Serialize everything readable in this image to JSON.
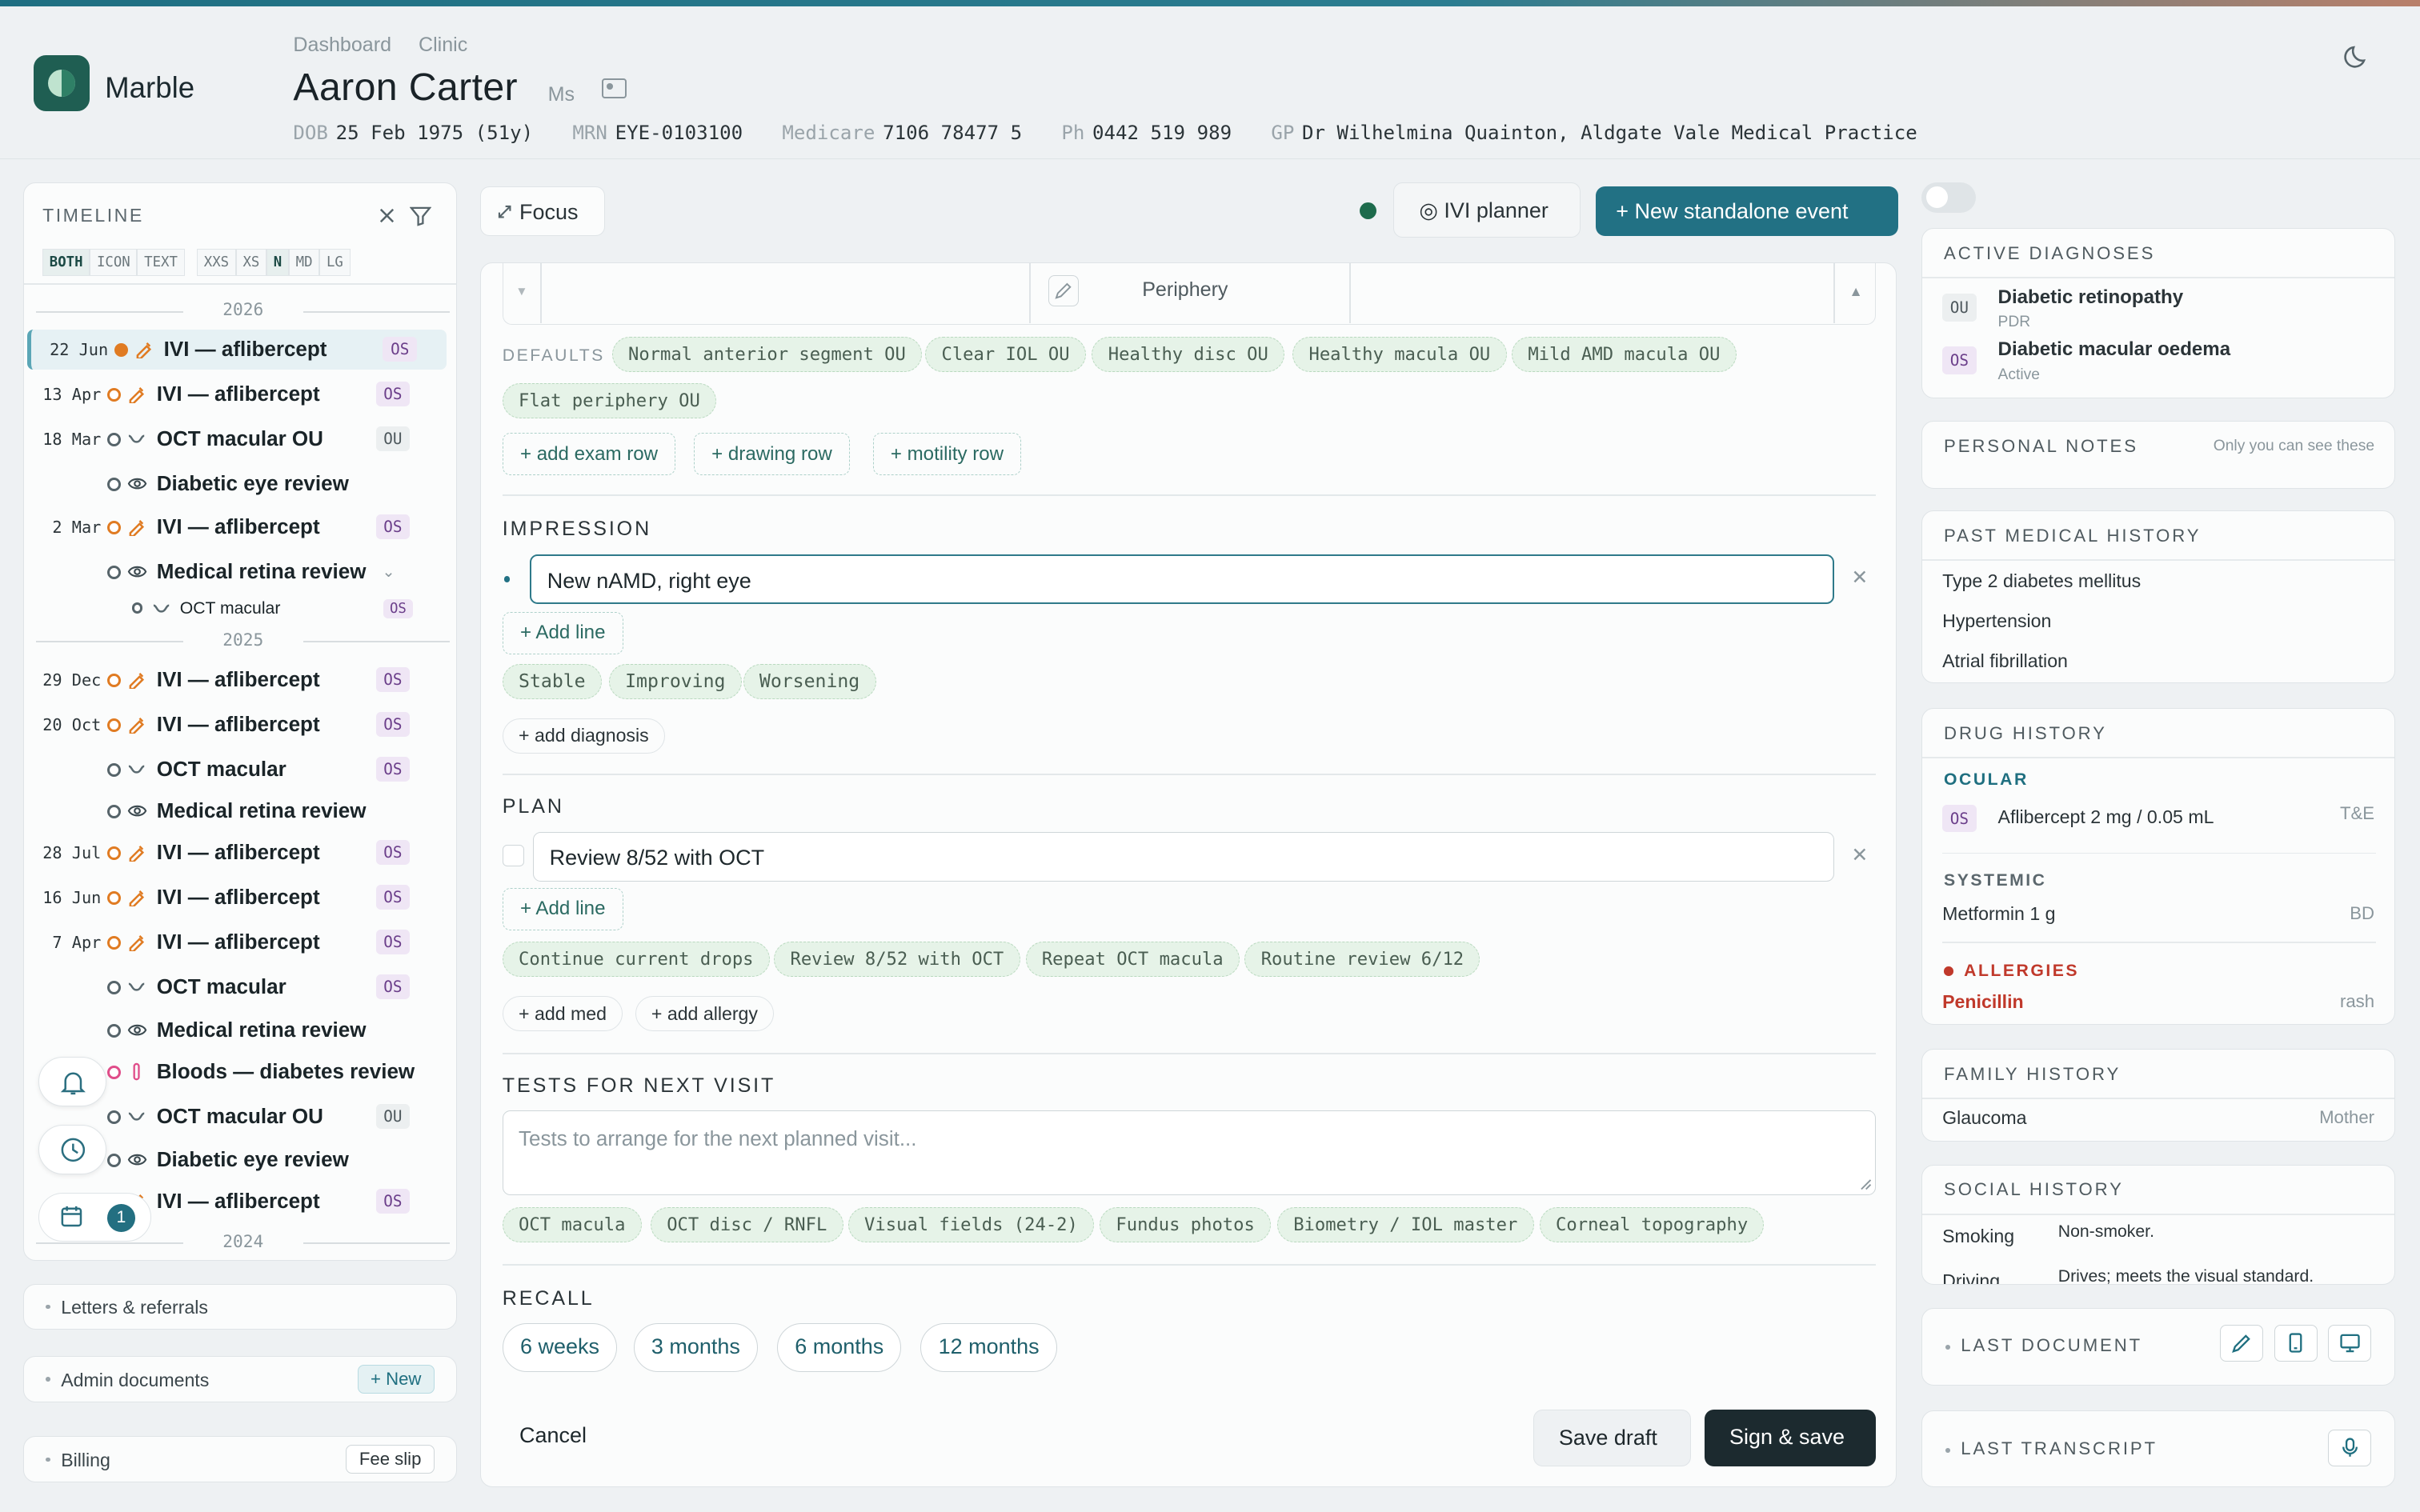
{
  "app": {
    "name": "Marble"
  },
  "breadcrumb": [
    "Dashboard",
    "Clinic"
  ],
  "patient": {
    "name": "Aaron Carter",
    "title": "Ms",
    "dob_label": "DOB",
    "dob": "25 Feb 1975 (51y)",
    "mrn_label": "MRN",
    "mrn": "EYE-0103100",
    "medicare_label": "Medicare",
    "medicare": "7106 78477 5",
    "ph_label": "Ph",
    "ph": "0442 519 989",
    "gp_label": "GP",
    "gp": "Dr Wilhelmina Quainton, Aldgate Vale Medical Practice"
  },
  "timeline": {
    "title": "TIMELINE",
    "view_modes": [
      "BOTH",
      "ICON",
      "TEXT"
    ],
    "sizes": [
      "XXS",
      "XS",
      "N",
      "MD",
      "LG"
    ],
    "years": [
      "2026",
      "2025",
      "2024"
    ],
    "events": [
      {
        "date": "22 Jun",
        "title": "IVI — aflibercept",
        "eye": "OS",
        "icon": "syringe-icon",
        "selected": true
      },
      {
        "date": "13 Apr",
        "title": "IVI — aflibercept",
        "eye": "OS",
        "icon": "syringe-icon"
      },
      {
        "date": "18 Mar",
        "title": "OCT macular OU",
        "eye": "OU",
        "icon": "scan-icon"
      },
      {
        "date": "",
        "title": "Diabetic eye review",
        "eye": "",
        "icon": "eye-icon"
      },
      {
        "date": "2 Mar",
        "title": "IVI — aflibercept",
        "eye": "OS",
        "icon": "syringe-icon"
      },
      {
        "date": "",
        "title": "Medical retina review",
        "eye": "",
        "icon": "eye-icon"
      },
      {
        "date": "",
        "title": "OCT macular",
        "eye": "OS",
        "icon": "scan-icon"
      },
      {
        "date": "29 Dec",
        "title": "IVI — aflibercept",
        "eye": "OS",
        "icon": "syringe-icon"
      },
      {
        "date": "20 Oct",
        "title": "IVI — aflibercept",
        "eye": "OS",
        "icon": "syringe-icon"
      },
      {
        "date": "",
        "title": "OCT macular",
        "eye": "OS",
        "icon": "scan-icon"
      },
      {
        "date": "",
        "title": "Medical retina review",
        "eye": "",
        "icon": "eye-icon"
      },
      {
        "date": "28 Jul",
        "title": "IVI — aflibercept",
        "eye": "OS",
        "icon": "syringe-icon"
      },
      {
        "date": "16 Jun",
        "title": "IVI — aflibercept",
        "eye": "OS",
        "icon": "syringe-icon"
      },
      {
        "date": "7 Apr",
        "title": "IVI — aflibercept",
        "eye": "OS",
        "icon": "syringe-icon"
      },
      {
        "date": "",
        "title": "OCT macular",
        "eye": "OS",
        "icon": "scan-icon"
      },
      {
        "date": "",
        "title": "Medical retina review",
        "eye": "",
        "icon": "eye-icon"
      },
      {
        "date": "",
        "title": "Bloods — diabetes review",
        "eye": "",
        "icon": "blood-tube-icon"
      },
      {
        "date": "",
        "title": "OCT macular OU",
        "eye": "OU",
        "icon": "scan-icon"
      },
      {
        "date": "",
        "title": "Diabetic eye review",
        "eye": "",
        "icon": "eye-icon"
      },
      {
        "date": "",
        "title": "IVI — aflibercept",
        "eye": "OS",
        "icon": "syringe-icon"
      }
    ],
    "notification_count": "1"
  },
  "side_sections": {
    "letters": "Letters & referrals",
    "admin": "Admin documents",
    "admin_new": "+ New",
    "billing": "Billing",
    "fee_slip": "Fee slip"
  },
  "toolbar": {
    "focus": "Focus",
    "ivi_planner": "◎ IVI planner",
    "new_event": "+ New standalone event"
  },
  "exam": {
    "periphery_label": "Periphery",
    "defaults_label": "DEFAULTS",
    "defaults": [
      "Normal anterior segment OU",
      "Clear IOL OU",
      "Healthy disc OU",
      "Healthy macula OU",
      "Mild AMD macula OU",
      "Flat periphery OU"
    ],
    "add_buttons": [
      "+ add exam row",
      "+ drawing row",
      "+ motility row"
    ]
  },
  "impression": {
    "title": "IMPRESSION",
    "line": "New nAMD, right eye",
    "add_line": "+ Add line",
    "status_chips": [
      "Stable",
      "Improving",
      "Worsening"
    ],
    "add_diagnosis": "+ add diagnosis"
  },
  "plan": {
    "title": "PLAN",
    "line": "Review 8/52 with OCT",
    "add_line": "+ Add line",
    "chips": [
      "Continue current drops",
      "Review 8/52 with OCT",
      "Repeat OCT macula",
      "Routine review 6/12"
    ],
    "add_med": "+ add med",
    "add_allergy": "+ add allergy"
  },
  "tests": {
    "title": "TESTS FOR NEXT VISIT",
    "placeholder": "Tests to arrange for the next planned visit...",
    "chips": [
      "OCT macula",
      "OCT disc / RNFL",
      "Visual fields (24-2)",
      "Fundus photos",
      "Biometry / IOL master",
      "Corneal topography"
    ]
  },
  "recall": {
    "title": "RECALL",
    "options": [
      "6 weeks",
      "3 months",
      "6 months",
      "12 months"
    ]
  },
  "footer": {
    "cancel": "Cancel",
    "save_draft": "Save draft",
    "sign_save": "Sign & save"
  },
  "right": {
    "active_diagnoses": {
      "title": "ACTIVE DIAGNOSES",
      "items": [
        {
          "eye": "OU",
          "name": "Diabetic retinopathy",
          "sub": "PDR"
        },
        {
          "eye": "OS",
          "name": "Diabetic macular oedema",
          "sub": "Active"
        }
      ]
    },
    "personal_notes": {
      "title": "PERSONAL NOTES",
      "hint": "Only you can see these"
    },
    "pmh": {
      "title": "PAST MEDICAL HISTORY",
      "items": [
        "Type 2 diabetes mellitus",
        "Hypertension",
        "Atrial fibrillation"
      ]
    },
    "drug_history": {
      "title": "DRUG HISTORY",
      "ocular_label": "OCULAR",
      "ocular": {
        "eye": "OS",
        "name": "Aflibercept 2 mg / 0.05 mL",
        "freq": "T&E"
      },
      "systemic_label": "SYSTEMIC",
      "systemic": {
        "name": "Metformin 1 g",
        "freq": "BD"
      },
      "allergies_label": "ALLERGIES",
      "allergy": {
        "name": "Penicillin",
        "reaction": "rash"
      }
    },
    "family_history": {
      "title": "FAMILY HISTORY",
      "item": "Glaucoma",
      "relation": "Mother"
    },
    "social_history": {
      "title": "SOCIAL HISTORY",
      "rows": [
        {
          "k": "Smoking",
          "v": "Non-smoker."
        },
        {
          "k": "Driving",
          "v": "Drives; meets the visual standard."
        }
      ]
    },
    "last_document": "LAST DOCUMENT",
    "last_transcript": "LAST TRANSCRIPT"
  },
  "colors": {
    "accent": "#227184",
    "brand": "#1f5e52",
    "allergy": "#c0392b",
    "os_badge": "#6b3e8a"
  }
}
